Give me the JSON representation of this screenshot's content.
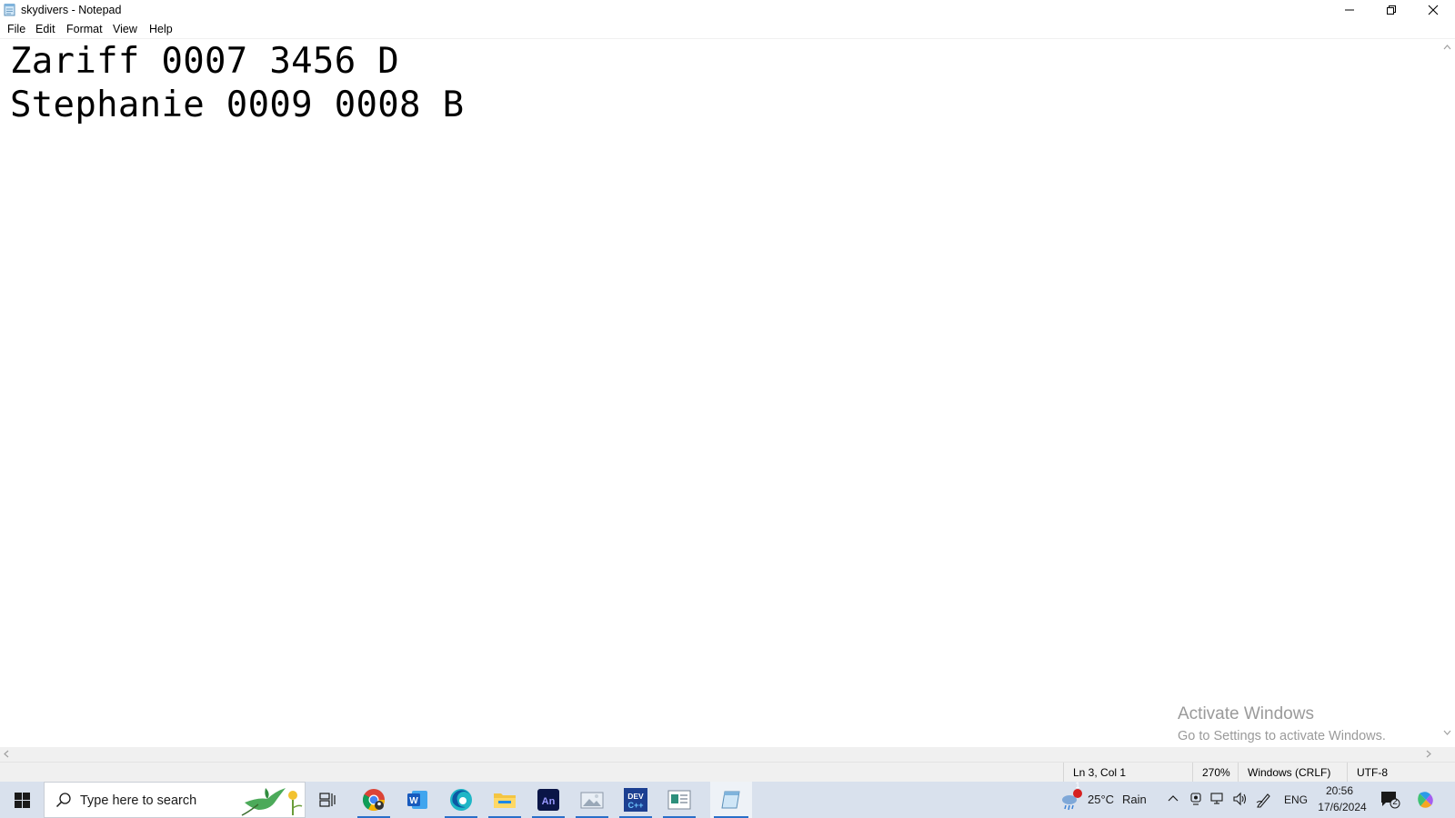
{
  "window": {
    "title": "skydivers - Notepad",
    "icons": {
      "app": "notepad-icon",
      "minimize": "minimize-icon",
      "maximize": "restore-icon",
      "close": "close-icon"
    }
  },
  "menu": {
    "items": [
      "File",
      "Edit",
      "Format",
      "View",
      "Help"
    ]
  },
  "editor": {
    "lines": [
      "Zariff 0007 3456 D",
      "Stephanie 0009 0008 B"
    ]
  },
  "watermark": {
    "title": "Activate Windows",
    "subtitle": "Go to Settings to activate Windows."
  },
  "status": {
    "position": "Ln 3, Col 1",
    "zoom": "270%",
    "line_ending": "Windows (CRLF)",
    "encoding": "UTF-8"
  },
  "taskbar": {
    "search_placeholder": "Type here to search",
    "apps": [
      "start-icon",
      "task-view-icon",
      "chrome-icon",
      "word-icon",
      "edge-icon",
      "file-explorer-icon",
      "animate-icon",
      "photos-icon",
      "devc-icon",
      "news-icon",
      "notepad-icon"
    ],
    "weather": {
      "temp": "25°C",
      "condition": "Rain",
      "badge": "1"
    },
    "language": "ENG",
    "time": "20:56",
    "date": "17/6/2024",
    "notification_count": "2"
  },
  "colors": {
    "taskbar_bg": "#d9e1ed",
    "accent": "#2a6fc9",
    "watermark": "#9a9a9a"
  }
}
